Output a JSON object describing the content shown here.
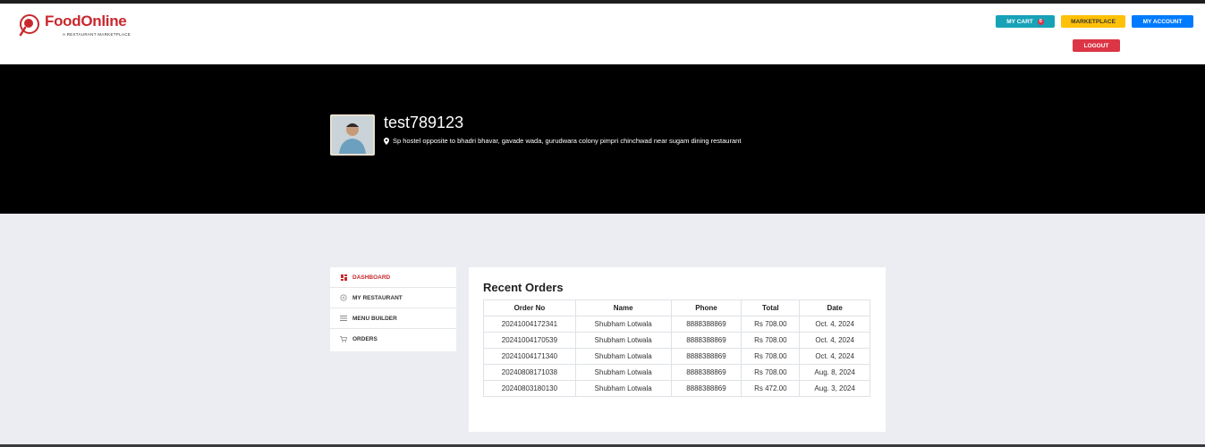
{
  "brand": {
    "name": "FoodOnline",
    "tagline": "A RESTAURANT MARKETPLACE",
    "color": "#c8282d"
  },
  "header": {
    "cart_label": "MY CART",
    "cart_count": "0",
    "marketplace_label": "MARKETPLACE",
    "account_label": "MY ACCOUNT",
    "logout_label": "LOGOUT"
  },
  "profile": {
    "restaurant_name": "test789123",
    "address": "Sp hostel opposite to bhadri bhavar, gavade wada, gurudwara colony pimpri chinchwad near sugam dining restaurant",
    "location_icon": "map-marker-icon"
  },
  "sidebar": {
    "items": [
      {
        "label": "DASHBOARD",
        "icon": "dashboard-icon"
      },
      {
        "label": "MY RESTAURANT",
        "icon": "restaurant-icon"
      },
      {
        "label": "MENU BUILDER",
        "icon": "menu-icon"
      },
      {
        "label": "ORDERS",
        "icon": "cart-icon"
      }
    ]
  },
  "orders": {
    "title": "Recent Orders",
    "columns": [
      "Order No",
      "Name",
      "Phone",
      "Total",
      "Date"
    ],
    "rows": [
      [
        "20241004172341",
        "Shubham Lotwala",
        "8888388869",
        "Rs 708.00",
        "Oct. 4, 2024"
      ],
      [
        "20241004170539",
        "Shubham Lotwala",
        "8888388869",
        "Rs 708.00",
        "Oct. 4, 2024"
      ],
      [
        "20241004171340",
        "Shubham Lotwala",
        "8888388869",
        "Rs 708.00",
        "Oct. 4, 2024"
      ],
      [
        "20240808171038",
        "Shubham Lotwala",
        "8888388869",
        "Rs 708.00",
        "Aug. 8, 2024"
      ],
      [
        "20240803180130",
        "Shubham Lotwala",
        "8888388869",
        "Rs 472.00",
        "Aug. 3, 2024"
      ]
    ]
  },
  "colors": {
    "cart_button": "#17a2b8",
    "marketplace_button": "#ffc107",
    "account_button": "#007bff",
    "logout_button": "#dc3545",
    "hero_background": "#000000",
    "page_background": "#ebedf2"
  }
}
